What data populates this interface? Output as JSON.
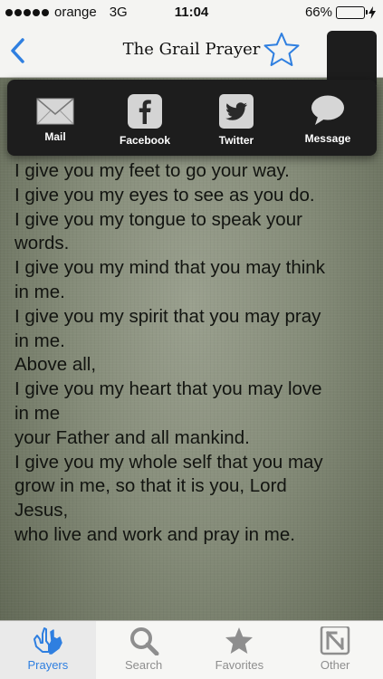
{
  "status_bar": {
    "carrier": "orange",
    "network": "3G",
    "time": "11:04",
    "battery_percent": "66%",
    "battery_level": 0.66
  },
  "nav_bar": {
    "title": "The Grail Prayer",
    "accent_color": "#2f7fe0"
  },
  "share_menu": {
    "items": [
      {
        "label": "Mail",
        "icon": "mail-icon"
      },
      {
        "label": "Facebook",
        "icon": "facebook-icon"
      },
      {
        "label": "Twitter",
        "icon": "twitter-icon"
      },
      {
        "label": "Message",
        "icon": "message-icon"
      }
    ]
  },
  "prayer": {
    "lines": [
      "I give you my feet to go your way.",
      "I give you my eyes to see as you do.",
      "I give you my tongue to speak your",
      "words.",
      "I give you my mind that you may think",
      "in me.",
      "I give you my spirit that you may pray",
      "in me.",
      "Above all,",
      "I give you my heart that you may love",
      "in me",
      "your Father and all mankind.",
      "I give you my whole self that you may",
      "grow in me, so that it is you, Lord",
      "Jesus,",
      "who live and work and pray in me."
    ]
  },
  "tab_bar": {
    "tabs": [
      {
        "label": "Prayers",
        "icon": "praying-hands-icon",
        "active": true
      },
      {
        "label": "Search",
        "icon": "search-icon",
        "active": false
      },
      {
        "label": "Favorites",
        "icon": "star-icon",
        "active": false
      },
      {
        "label": "Other",
        "icon": "other-app-icon",
        "active": false
      }
    ]
  }
}
